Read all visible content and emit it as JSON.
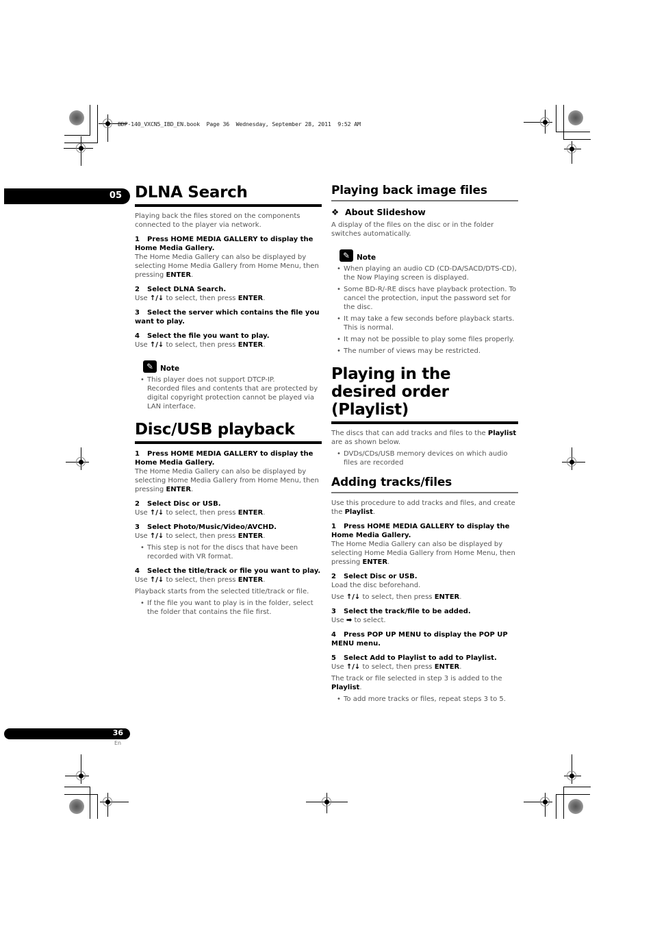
{
  "header": {
    "print_line": "BDP-140_VXCN5_IBD_EN.book  Page 36  Wednesday, September 28, 2011  9:52 AM"
  },
  "chapter_tab": "05",
  "footer": {
    "page_number": "36",
    "language": "En"
  },
  "icons": {
    "note": "pencil-note-icon",
    "up_down_arrows": "↑/↓",
    "right_arrow": "➡",
    "diamond": "❖"
  },
  "left": {
    "dlna": {
      "title": "DLNA Search",
      "intro": "Playing back the files stored on the components connected to the player via network.",
      "steps": [
        {
          "n": "1",
          "title": "Press HOME MEDIA GALLERY to display the Home Media Gallery.",
          "body_pre": "The Home Media Gallery can also be displayed by selecting Home Media Gallery from Home Menu, then pressing ",
          "body_bold": "ENTER",
          "body_post": "."
        },
        {
          "n": "2",
          "title": "Select DLNA Search.",
          "use_pre": "Use ",
          "use_keys": "↑/↓",
          "use_mid": " to select, then press ",
          "use_bold": "ENTER",
          "use_post": "."
        },
        {
          "n": "3",
          "title": "Select the server which contains the file you want to play."
        },
        {
          "n": "4",
          "title": "Select the file you want to play.",
          "use_pre": "Use ",
          "use_keys": "↑/↓",
          "use_mid": " to select, then press ",
          "use_bold": "ENTER",
          "use_post": "."
        }
      ],
      "note_label": "Note",
      "notes": [
        "This player does not support DTCP-IP.",
        "Recorded files and contents that are protected by digital copyright protection cannot be played via LAN interface."
      ]
    },
    "disc": {
      "title": "Disc/USB playback",
      "steps": [
        {
          "n": "1",
          "title": "Press HOME MEDIA GALLERY to display the Home Media Gallery.",
          "body_pre": "The Home Media Gallery can also be displayed by selecting Home Media Gallery from Home Menu, then pressing ",
          "body_bold": "ENTER",
          "body_post": "."
        },
        {
          "n": "2",
          "title": "Select Disc or USB.",
          "use_pre": "Use ",
          "use_keys": "↑/↓",
          "use_mid": " to select, then press ",
          "use_bold": "ENTER",
          "use_post": "."
        },
        {
          "n": "3",
          "title": "Select Photo/Music/Video/AVCHD.",
          "use_pre": "Use ",
          "use_keys": "↑/↓",
          "use_mid": " to select, then press ",
          "use_bold": "ENTER",
          "use_post": ".",
          "bullet": "This step is not for the discs that have been recorded with VR format."
        },
        {
          "n": "4",
          "title": "Select the title/track or file you want to play.",
          "use_pre": "Use ",
          "use_keys": "↑/↓",
          "use_mid": " to select, then press ",
          "use_bold": "ENTER",
          "use_post": ".",
          "extra": "Playback starts from the selected title/track or file.",
          "bullet": "If the file you want to play is in the folder, select the folder that contains the file first."
        }
      ]
    }
  },
  "right": {
    "image": {
      "title": "Playing back image files",
      "sub_title": "About Slideshow",
      "sub_body": "A display of the files on the disc or in the folder switches automatically.",
      "note_label": "Note",
      "notes": [
        "When playing an audio CD (CD-DA/SACD/DTS-CD), the Now Playing screen is displayed.",
        "Some BD-R/-RE discs have playback protection. To cancel the protection, input the password set for the disc.",
        "It may take a few seconds before playback starts. This is normal.",
        "It may not be possible to play some files properly.",
        "The number of views may be restricted."
      ]
    },
    "playlist": {
      "title": "Playing in the desired order (Playlist)",
      "intro_pre": "The discs that can add tracks and files to the ",
      "intro_bold": "Playlist",
      "intro_post": " are as shown below.",
      "bullet": "DVDs/CDs/USB memory devices on which audio files are recorded"
    },
    "adding": {
      "title": "Adding tracks/files",
      "intro_pre": "Use this procedure to add tracks and files, and create the ",
      "intro_bold": "Playlist",
      "intro_post": ".",
      "steps": [
        {
          "n": "1",
          "title": "Press HOME MEDIA GALLERY to display the Home Media Gallery.",
          "body_pre": "The Home Media Gallery can also be displayed by selecting Home Media Gallery from Home Menu, then pressing ",
          "body_bold": "ENTER",
          "body_post": "."
        },
        {
          "n": "2",
          "title": "Select Disc or USB.",
          "extra": "Load the disc beforehand.",
          "use_pre": "Use ",
          "use_keys": "↑/↓",
          "use_mid": " to select, then press ",
          "use_bold": "ENTER",
          "use_post": "."
        },
        {
          "n": "3",
          "title": "Select the track/file to be added.",
          "use_pre": "Use ",
          "use_keys": "➡",
          "use_mid": " to select."
        },
        {
          "n": "4",
          "title": "Press POP UP MENU to display the POP UP MENU menu."
        },
        {
          "n": "5",
          "title": "Select Add to Playlist to add to Playlist.",
          "use_pre": "Use ",
          "use_keys": "↑/↓",
          "use_mid": " to select, then press ",
          "use_bold": "ENTER",
          "use_post": ".",
          "result_pre": "The track or file selected in step 3 is added to the ",
          "result_bold": "Playlist",
          "result_post": ".",
          "bullet": "To add more tracks or files, repeat steps 3 to 5."
        }
      ]
    }
  }
}
